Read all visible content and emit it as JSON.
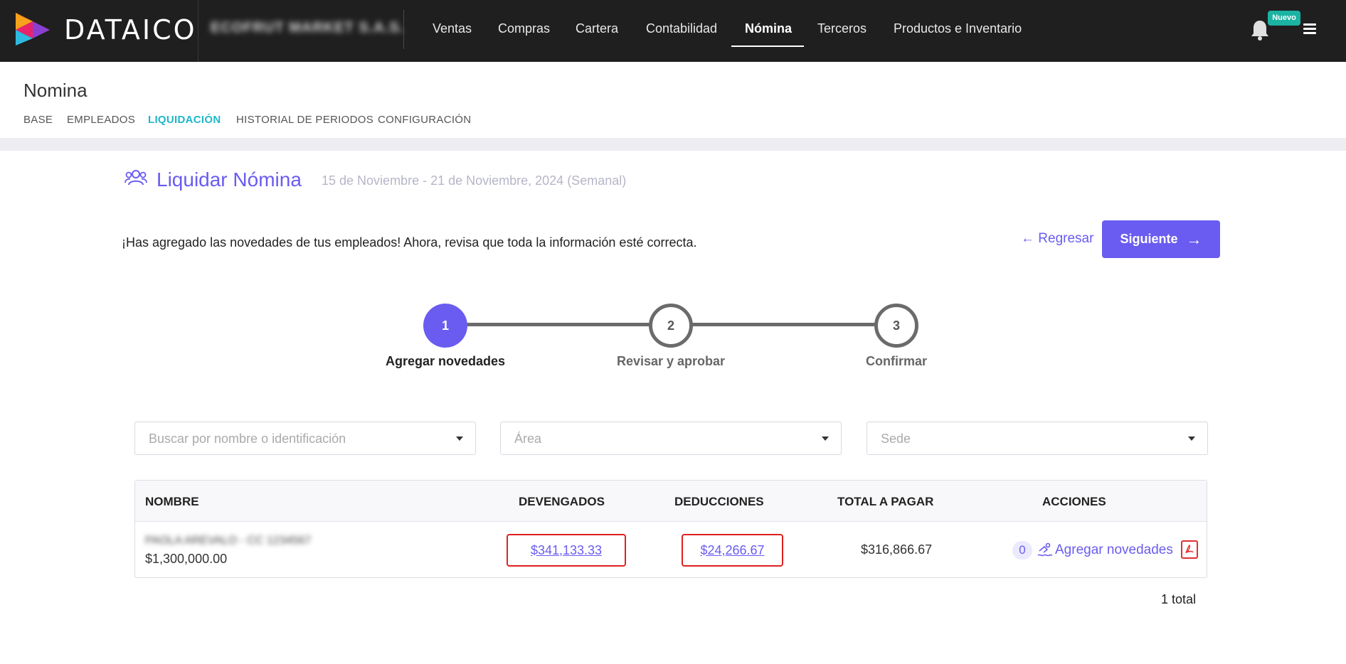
{
  "app": {
    "brand": "DATAICO",
    "company": "ECOFRUT MARKET S.A.S."
  },
  "nav": {
    "items": [
      {
        "label": "Ventas"
      },
      {
        "label": "Compras"
      },
      {
        "label": "Cartera"
      },
      {
        "label": "Contabilidad"
      },
      {
        "label": "Nómina",
        "active": true
      },
      {
        "label": "Terceros"
      },
      {
        "label": "Productos e Inventario"
      }
    ],
    "badge": "Nuevo",
    "icons": [
      "bell-icon",
      "menu-icon"
    ]
  },
  "page": {
    "title": "Nomina",
    "tabs": [
      {
        "label": "BASE"
      },
      {
        "label": "EMPLEADOS"
      },
      {
        "label": "LIQUIDACIÓN",
        "active": true
      },
      {
        "label": "HISTORIAL DE PERIODOS"
      },
      {
        "label": "CONFIGURACIÓN"
      }
    ]
  },
  "section": {
    "title": "Liquidar Nómina",
    "period": "15 de Noviembre - 21 de Noviembre, 2024 (Semanal)",
    "info": "¡Has agregado las novedades de tus empleados! Ahora, revisa que toda la información esté correcta.",
    "back_label": "Regresar",
    "next_label": "Siguiente"
  },
  "stepper": {
    "steps": [
      {
        "number": "1",
        "label": "Agregar novedades",
        "state": "active"
      },
      {
        "number": "2",
        "label": "Revisar y aprobar",
        "state": "pending"
      },
      {
        "number": "3",
        "label": "Confirmar",
        "state": "pending"
      }
    ]
  },
  "filters": {
    "search_placeholder": "Buscar por nombre o identificación",
    "area_placeholder": "Área",
    "sede_placeholder": "Sede"
  },
  "table": {
    "headers": {
      "name": "NOMBRE",
      "devengados": "DEVENGADOS",
      "deducciones": "DEDUCCIONES",
      "total": "TOTAL A PAGAR",
      "acciones": "ACCIONES"
    },
    "rows": [
      {
        "name": "PAOLA AREVALO - CC 1234567",
        "salary": "$1,300,000.00",
        "devengados": "$341,133.33",
        "deducciones": "$24,266.67",
        "total": "$316,866.67",
        "novedades_count": "0",
        "action_label": "Agregar novedades"
      }
    ],
    "footer": "1  total"
  },
  "colors": {
    "accent": "#6a5cf0",
    "topbar": "#1f1f1f",
    "active_tab": "#1fb7c9",
    "badge": "#1bb3a2",
    "highlight": "#e02020"
  }
}
